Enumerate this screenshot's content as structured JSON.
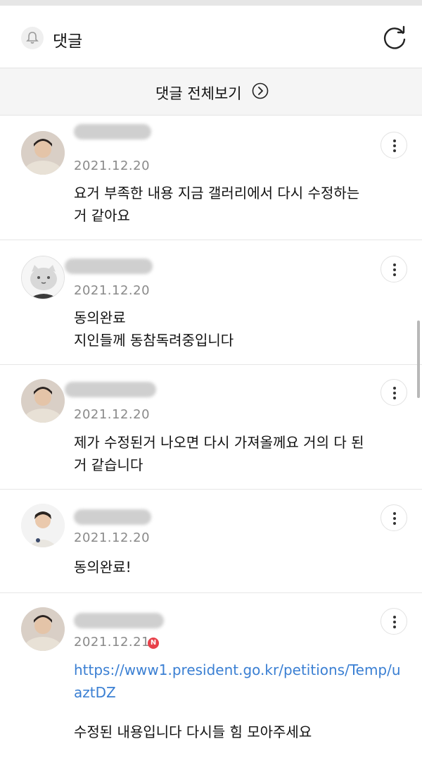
{
  "header": {
    "title": "댓글",
    "bell_icon": "bell-icon",
    "refresh_icon": "refresh-icon"
  },
  "view_all": {
    "label": "댓글 전체보기",
    "arrow_icon": "chevron-right-circle-icon"
  },
  "comments": [
    {
      "author": "",
      "avatar": "person-photo-avatar",
      "date": "2021.12.20",
      "text": "요거 부족한 내용 지금 갤러리에서 다시 수정하는\n거 같아요"
    },
    {
      "author": "",
      "avatar": "cartoon-face-avatar",
      "date": "2021.12.20",
      "text": "동의완료\n지인들께 동참독려중입니다"
    },
    {
      "author": "",
      "avatar": "person-photo-avatar",
      "date": "2021.12.20",
      "text": "제가 수정된거 나오면 다시 가져올께요 거의 다 된\n거 같습니다"
    },
    {
      "author": "",
      "avatar": "person-photo-avatar",
      "date": "2021.12.20",
      "text": "동의완료!"
    },
    {
      "author": "",
      "avatar": "person-photo-avatar",
      "date": "2021.12.21",
      "badge": "N",
      "link": "https://www1.president.go.kr/petitions/Temp/uaztDZ",
      "text": "수정된 내용입니다 다시들 힘 모아주세요"
    }
  ],
  "colors": {
    "link": "#3a7fd3",
    "date": "#8a8a8a",
    "badge": "#e8414a",
    "view_all_bg": "#f5f5f5"
  }
}
